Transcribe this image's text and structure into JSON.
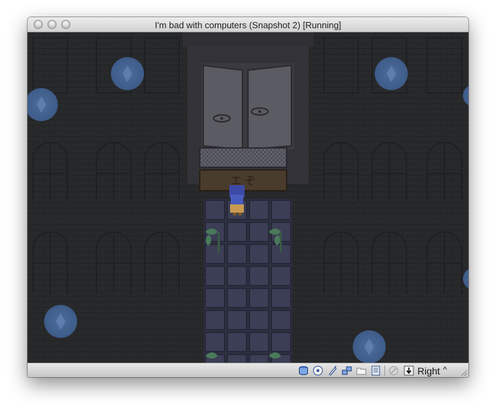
{
  "window": {
    "title": "I'm bad with computers (Snapshot 2) [Running]",
    "buttons": [
      "close",
      "minimize",
      "zoom"
    ]
  },
  "statusbar": {
    "icons": [
      "hard-disk-icon",
      "optical-drive-icon",
      "usb-icon",
      "network-icon",
      "shared-folder-icon",
      "display-icon",
      "mouse-integration-icon",
      "host-key-arrow-icon"
    ],
    "host_key_label": "Right",
    "host_key_caret": "^"
  },
  "game": {
    "sign_text": "エ    ぞ"
  }
}
